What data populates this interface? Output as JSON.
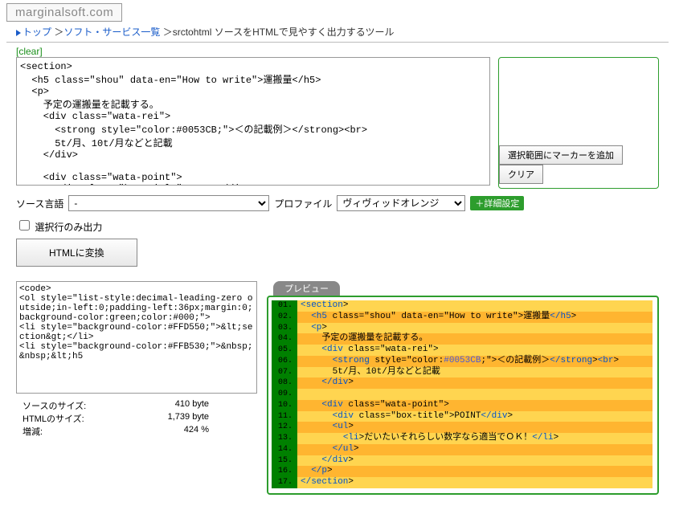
{
  "logo": "marginalsoft.com",
  "breadcrumb": {
    "top": "トップ",
    "list": "ソフト・サービス一覧",
    "current": "srctohtml ソースをHTMLで見やすく出力するツール"
  },
  "clear_label": "[clear]",
  "source_text": "<section>\n  <h5 class=\"shou\" data-en=\"How to write\">運搬量</h5>\n  <p>\n    予定の運搬量を記載する。\n    <div class=\"wata-rei\">\n      <strong style=\"color:#0053CB;\">＜の記載例＞</strong><br>\n      5t/月、10t/月などと記載\n    </div>\n\n    <div class=\"wata-point\">\n      <div class=\"box-title\">POINT</div>\n      <ul>\n        <li>だいたいそれらしい数字なら適当でＯＫ！</li>",
  "marker": {
    "add_label": "選択範囲にマーカーを追加",
    "clear_label": "クリア"
  },
  "labels": {
    "source_lang": "ソース言語",
    "profile": "プロファイル",
    "detail": "＋詳細設定",
    "selected_only": "選択行のみ出力",
    "convert": "HTMLに変換"
  },
  "lang_selected": "-",
  "profile_selected": "ヴィヴィッドオレンジ",
  "output_text": "<code>\n<ol style=\"list-style:decimal-leading-zero outside;in-left:0;padding-left:36px;margin:0;background-color:green;color:#000;\">\n<li style=\"background-color:#FFD550;\">&lt;section&gt;</li>\n<li style=\"background-color:#FFB530;\">&nbsp;&nbsp;&lt;h5",
  "stats": {
    "src_label": "ソースのサイズ:",
    "src_val": "410 byte",
    "html_label": "HTMLのサイズ:",
    "html_val": "1,739 byte",
    "ratio_label": "増減:",
    "ratio_val": "424 %"
  },
  "preview_tab": "プレビュー",
  "preview_lines": [
    "<section>",
    "  <h5 class=\"shou\" data-en=\"How to write\">運搬量</h5>",
    "  <p>",
    "    予定の運搬量を記載する。",
    "    <div class=\"wata-rei\">",
    "      <strong style=\"color:#0053CB;\">＜の記載例＞</strong><br>",
    "      5t/月、10t/月などと記載",
    "    </div>",
    "",
    "    <div class=\"wata-point\">",
    "      <div class=\"box-title\">POINT</div>",
    "      <ul>",
    "        <li>だいたいそれらしい数字なら適当でＯＫ！</li>",
    "      </ul>",
    "    </div>",
    "  </p>",
    "</section>"
  ]
}
